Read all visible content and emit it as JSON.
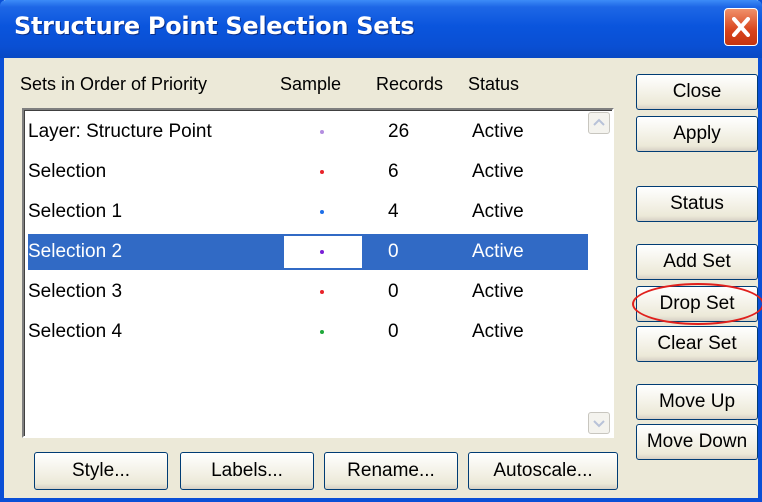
{
  "window": {
    "title": "Structure Point Selection Sets"
  },
  "columns": {
    "name": "Sets in Order of Priority",
    "sample": "Sample",
    "records": "Records",
    "status": "Status"
  },
  "rows": [
    {
      "name": "Layer: Structure Point",
      "records": "26",
      "status": "Active",
      "sample_color": "#b48ee0",
      "selected": false
    },
    {
      "name": "Selection",
      "records": "6",
      "status": "Active",
      "sample_color": "#e8232a",
      "selected": false
    },
    {
      "name": "Selection 1",
      "records": "4",
      "status": "Active",
      "sample_color": "#1e6fe8",
      "selected": false
    },
    {
      "name": "Selection 2",
      "records": "0",
      "status": "Active",
      "sample_color": "#7a1fd6",
      "selected": true
    },
    {
      "name": "Selection 3",
      "records": "0",
      "status": "Active",
      "sample_color": "#e8232a",
      "selected": false
    },
    {
      "name": "Selection 4",
      "records": "0",
      "status": "Active",
      "sample_color": "#1fa83a",
      "selected": false
    }
  ],
  "side_buttons": {
    "close": "Close",
    "apply": "Apply",
    "status": "Status",
    "add_set": "Add Set",
    "drop_set": "Drop Set",
    "clear_set": "Clear Set",
    "move_up": "Move Up",
    "move_down": "Move Down"
  },
  "bottom_buttons": {
    "style": "Style...",
    "labels": "Labels...",
    "rename": "Rename...",
    "autoscale": "Autoscale..."
  },
  "colors": {
    "titlebar": "#0a55dd",
    "selection": "#316ac5",
    "annotation": "#e0201c",
    "dialog_bg": "#ece9d8"
  }
}
